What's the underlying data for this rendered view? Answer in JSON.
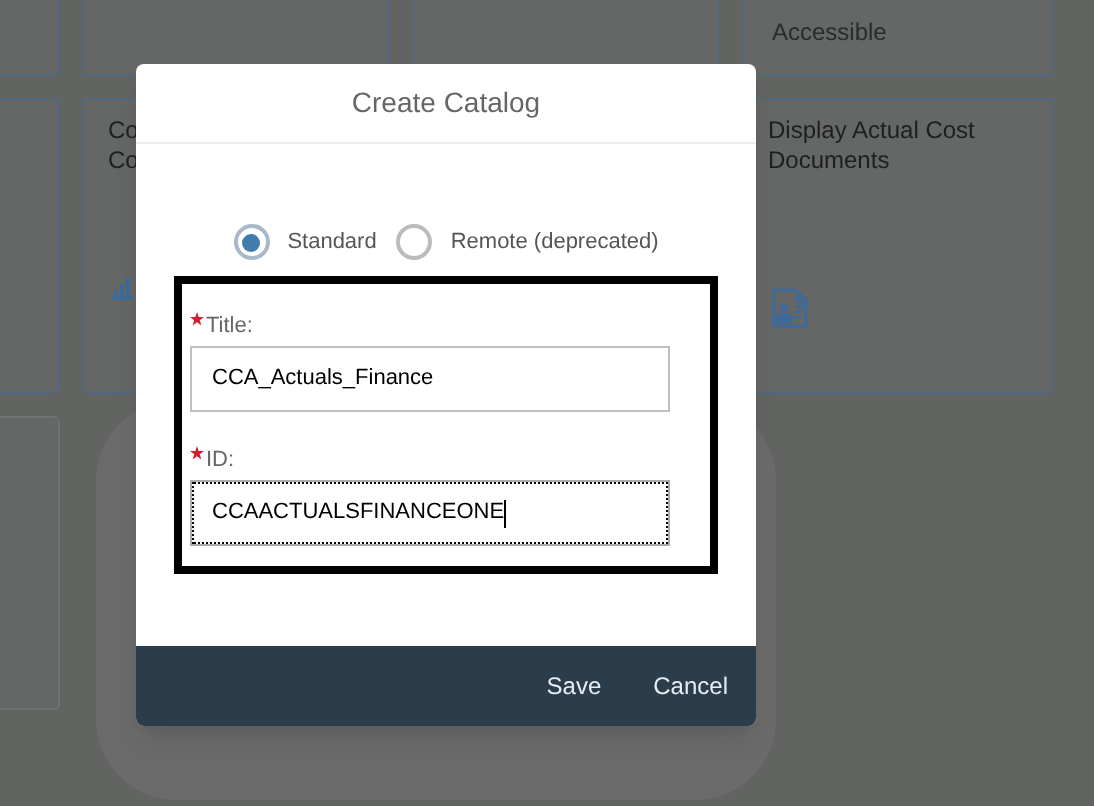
{
  "tiles": [
    {
      "kind": "footer",
      "subtitle": "Accessible"
    },
    {
      "kind": "app",
      "title_lines": [
        "Co",
        "Co"
      ]
    },
    {
      "kind": "app",
      "title_lines": [
        "Display Actual Cost",
        "Documents"
      ]
    }
  ],
  "dialog": {
    "title": "Create Catalog",
    "options": [
      {
        "label": "Standard",
        "selected": true
      },
      {
        "label": "Remote (deprecated)",
        "selected": false
      }
    ],
    "fields": [
      {
        "label": "Title:",
        "required": true,
        "value": "CCA_Actuals_Finance",
        "focused": false
      },
      {
        "label": "ID:",
        "required": true,
        "value": "CCAACTUALSFINANCEONE",
        "focused": true
      }
    ],
    "buttons": [
      "Save",
      "Cancel"
    ]
  }
}
